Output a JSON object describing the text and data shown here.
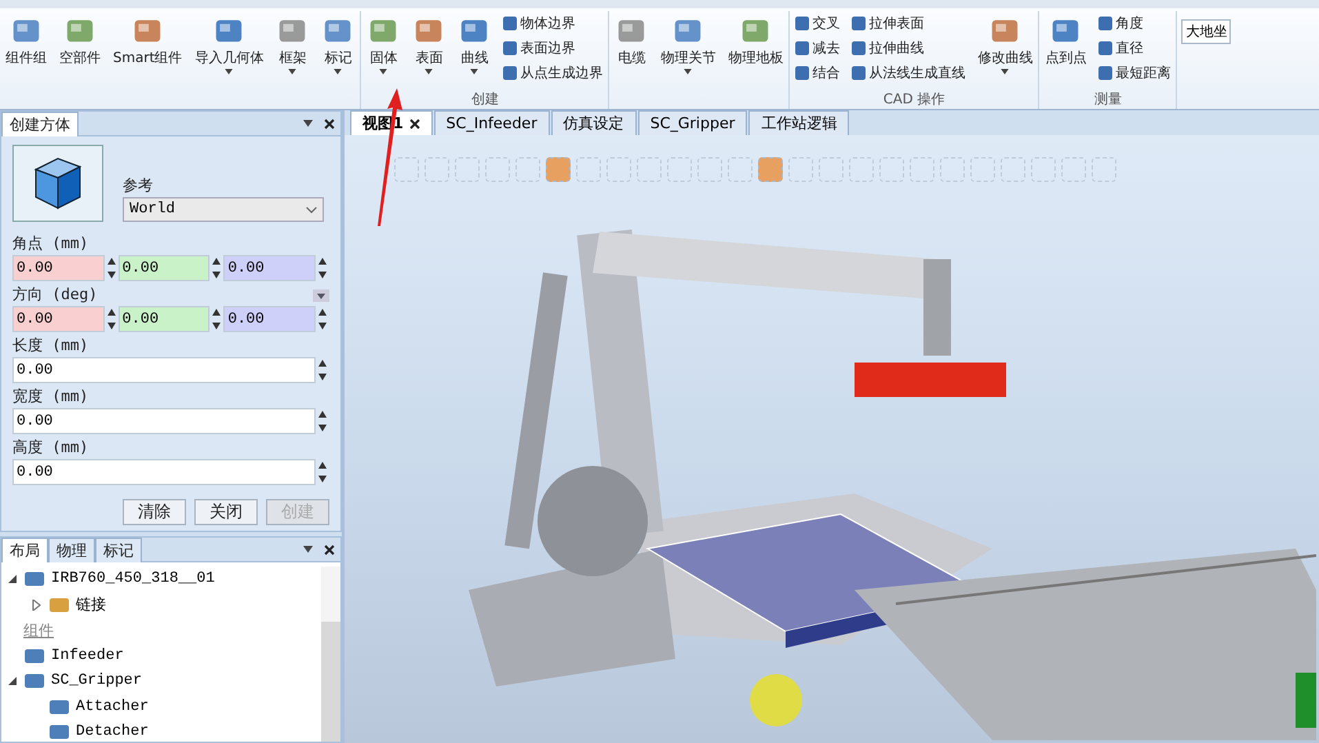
{
  "ribbon": {
    "groups": [
      {
        "items": [
          {
            "kind": "large",
            "label": "组件组",
            "dropdown": false
          },
          {
            "kind": "large",
            "label": "空部件",
            "dropdown": false
          },
          {
            "kind": "large",
            "label": "Smart组件",
            "dropdown": false
          },
          {
            "kind": "large",
            "label": "导入几何体",
            "dropdown": true
          },
          {
            "kind": "large",
            "label": "框架",
            "dropdown": true
          },
          {
            "kind": "large",
            "label": "标记",
            "dropdown": true
          }
        ]
      },
      {
        "label": "创建",
        "items": [
          {
            "kind": "large",
            "label": "固体",
            "dropdown": true
          },
          {
            "kind": "large",
            "label": "表面",
            "dropdown": true
          },
          {
            "kind": "large",
            "label": "曲线",
            "dropdown": true
          },
          {
            "kind": "stack",
            "entries": [
              "物体边界",
              "表面边界",
              "从点生成边界"
            ]
          }
        ]
      },
      {
        "items": [
          {
            "kind": "large",
            "label": "电缆",
            "dropdown": false
          },
          {
            "kind": "large",
            "label": "物理关节",
            "dropdown": true
          },
          {
            "kind": "large",
            "label": "物理地板",
            "dropdown": false
          }
        ]
      },
      {
        "label": "CAD 操作",
        "items": [
          {
            "kind": "stack",
            "entries": [
              "交叉",
              "减去",
              "结合"
            ]
          },
          {
            "kind": "stack",
            "entries": [
              "拉伸表面",
              "拉伸曲线",
              "从法线生成直线"
            ]
          },
          {
            "kind": "large",
            "label": "修改曲线",
            "dropdown": true
          }
        ]
      },
      {
        "label": "测量",
        "items": [
          {
            "kind": "large",
            "label": "点到点",
            "dropdown": false
          },
          {
            "kind": "stack",
            "entries": [
              "角度",
              "直径",
              "最短距离"
            ]
          }
        ]
      }
    ],
    "frame_select": {
      "value": "大地坐"
    }
  },
  "create_panel": {
    "tab": "创建方体",
    "reference_label": "参考",
    "reference_value": "World",
    "rows": [
      {
        "kind": "xyz",
        "label": "角点 (mm)",
        "values": [
          "0.00",
          "0.00",
          "0.00"
        ],
        "expander": false
      },
      {
        "kind": "xyz",
        "label": "方向 (deg)",
        "values": [
          "0.00",
          "0.00",
          "0.00"
        ],
        "expander": true
      },
      {
        "kind": "single",
        "label": "长度 (mm)",
        "values": [
          "0.00"
        ],
        "expander": false
      },
      {
        "kind": "single",
        "label": "宽度 (mm)",
        "values": [
          "0.00"
        ],
        "expander": false
      },
      {
        "kind": "single",
        "label": "高度 (mm)",
        "values": [
          "0.00"
        ],
        "expander": false
      }
    ],
    "buttons": [
      {
        "label": "清除",
        "disabled": false
      },
      {
        "label": "关闭",
        "disabled": false
      },
      {
        "label": "创建",
        "disabled": true
      }
    ]
  },
  "layout_panel": {
    "tabs": [
      {
        "label": "布局",
        "selected": true
      },
      {
        "label": "物理",
        "selected": false
      },
      {
        "label": "标记",
        "selected": false
      }
    ],
    "tree": [
      {
        "kind": "robot",
        "label": "IRB760_450_318__01",
        "expanded": true,
        "children": [
          {
            "kind": "folder",
            "label": "链接",
            "expanded": false
          }
        ]
      },
      {
        "kind": "heading",
        "label": "组件"
      },
      {
        "kind": "component",
        "label": "Infeeder"
      },
      {
        "kind": "component",
        "label": "SC_Gripper",
        "expanded": true,
        "children": [
          {
            "kind": "component",
            "label": "Attacher"
          },
          {
            "kind": "component",
            "label": "Detacher"
          }
        ]
      }
    ]
  },
  "view_tabs": [
    {
      "label": "视图1",
      "selected": true
    },
    {
      "label": "SC_Infeeder",
      "selected": false
    },
    {
      "label": "仿真设定",
      "selected": false
    },
    {
      "label": "SC_Gripper",
      "selected": false
    },
    {
      "label": "工作站逻辑",
      "selected": false
    }
  ],
  "view_tools": [
    {
      "on": false
    },
    {
      "on": false
    },
    {
      "on": false
    },
    {
      "on": false
    },
    {
      "on": false
    },
    {
      "on": true
    },
    {
      "on": false
    },
    {
      "on": false
    },
    {
      "on": false
    },
    {
      "on": false
    },
    {
      "on": false
    },
    {
      "on": false
    },
    {
      "on": true
    },
    {
      "on": false
    },
    {
      "on": false
    },
    {
      "on": false
    },
    {
      "on": false
    },
    {
      "on": false
    },
    {
      "on": false
    },
    {
      "on": false
    },
    {
      "on": false
    },
    {
      "on": false
    },
    {
      "on": false
    },
    {
      "on": false
    }
  ]
}
